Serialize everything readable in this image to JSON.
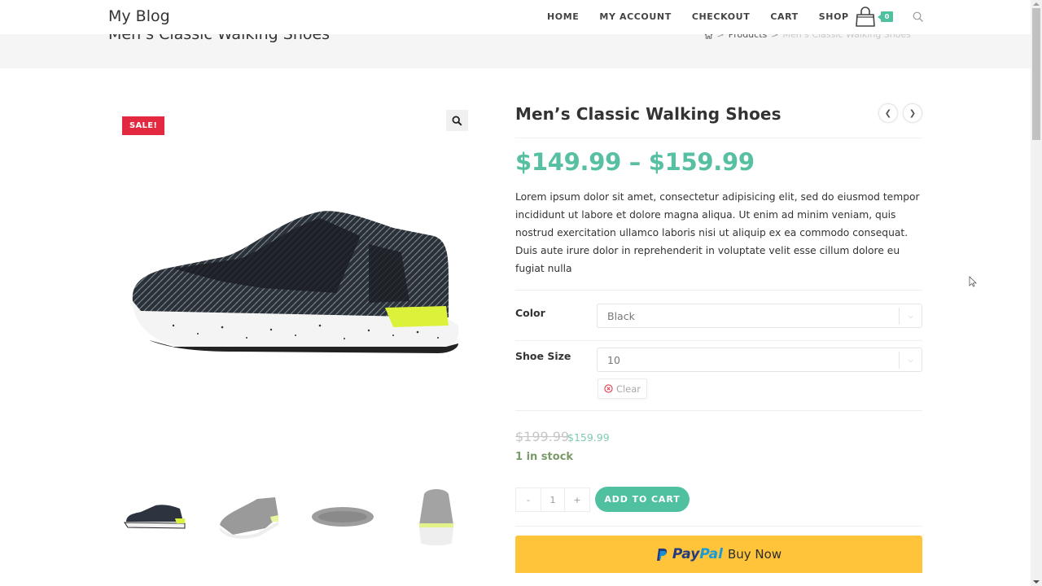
{
  "site": {
    "logo": "My Blog"
  },
  "nav": {
    "items": [
      "HOME",
      "MY ACCOUNT",
      "CHECKOUT",
      "CART",
      "SHOP"
    ],
    "cart_count": "0",
    "cart_icon": "shopping-bag-icon",
    "search_icon": "search-icon"
  },
  "page_header": {
    "title": "Men’s Classic Walking Shoes",
    "breadcrumb": {
      "home_icon": "home-icon",
      "separator": ">",
      "links": [
        "Products"
      ],
      "current": "Men’s Classic Walking Shoes"
    }
  },
  "gallery": {
    "sale_badge": "SALE!",
    "zoom_icon": "magnifier-icon",
    "main_image_alt": "Black patterned sneaker with white speckled sole and neon yellow heel",
    "thumbnails": [
      "Black sneaker side view",
      "Grey sneaker angled view",
      "Grey sneaker top view",
      "Grey sneaker back view"
    ]
  },
  "product": {
    "title": "Men’s Classic Walking Shoes",
    "prev_icon": "chevron-left-icon",
    "next_icon": "chevron-right-icon",
    "price_range": "$149.99 – $159.99",
    "description": "Lorem ipsum dolor sit amet, consectetur adipisicing elit, sed do eiusmod tempor incididunt ut labore et dolore magna aliqua. Ut enim ad minim veniam, quis nostrud exercitation ullamco laboris nisi ut aliquip ex ea commodo consequat. Duis aute irure dolor in reprehenderit in voluptate velit esse cillum dolore eu fugiat nulla",
    "variations": [
      {
        "label": "Color",
        "selected": "Black"
      },
      {
        "label": "Shoe Size",
        "selected": "10"
      }
    ],
    "clear_label": "Clear",
    "old_price": "$199.99",
    "new_price": "$159.99",
    "stock": "1 in stock",
    "quantity": {
      "minus": "-",
      "value": "1",
      "plus": "+"
    },
    "add_to_cart": "ADD TO CART",
    "paypal": {
      "pay": "Pay",
      "pal": "Pal",
      "label": "Buy Now"
    }
  },
  "colors": {
    "accent": "#4fc0a0",
    "price": "#57bfa2",
    "sale": "#e2293f",
    "paypal_yellow": "#ffc439",
    "stock": "#7a9a6a"
  }
}
